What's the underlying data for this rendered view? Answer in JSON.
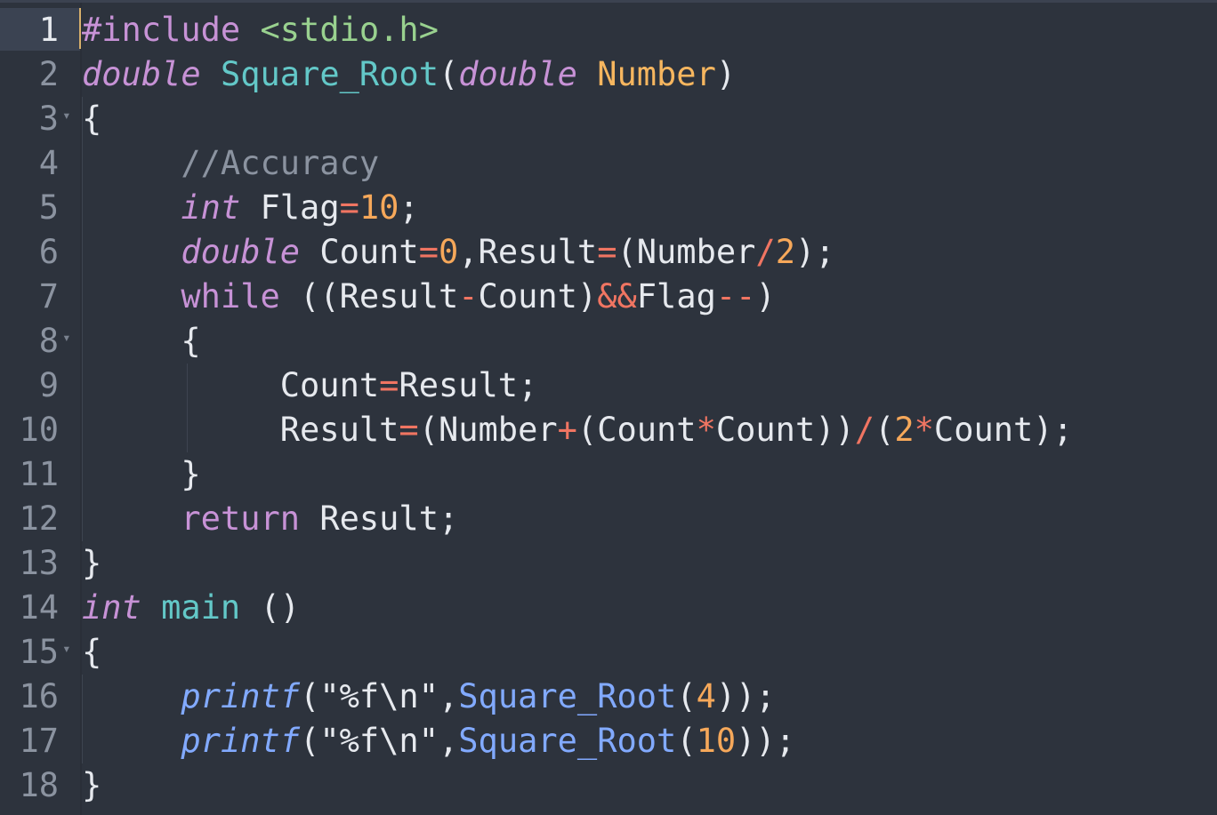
{
  "editor": {
    "language": "c",
    "current_line": 1,
    "theme_colors": {
      "background": "#2d333d",
      "keyword": "#c792d6",
      "function": "#63c8c8",
      "parameter": "#f6b65f",
      "operator": "#f07562",
      "number": "#f6a85a",
      "comment": "#8b93a0",
      "call": "#82aaff",
      "header": "#99d18f",
      "text": "#e6e9ee",
      "cursor": "#d7b06b"
    },
    "lines": [
      {
        "number": "1",
        "foldable": false,
        "tokens": [
          {
            "t": "#include",
            "c": "pp"
          },
          {
            "t": " ",
            "c": "tx"
          },
          {
            "t": "<stdio.h>",
            "c": "hdr"
          }
        ]
      },
      {
        "number": "2",
        "foldable": false,
        "tokens": [
          {
            "t": "double",
            "c": "kw-i"
          },
          {
            "t": " ",
            "c": "tx"
          },
          {
            "t": "Square_Root",
            "c": "fn"
          },
          {
            "t": "(",
            "c": "tx"
          },
          {
            "t": "double",
            "c": "kw-i"
          },
          {
            "t": " ",
            "c": "tx"
          },
          {
            "t": "Number",
            "c": "prm"
          },
          {
            "t": ")",
            "c": "tx"
          }
        ]
      },
      {
        "number": "3",
        "foldable": true,
        "tokens": [
          {
            "t": "{",
            "c": "tx"
          }
        ]
      },
      {
        "number": "4",
        "foldable": false,
        "tokens": [
          {
            "t": "     //Accuracy",
            "c": "cm"
          }
        ]
      },
      {
        "number": "5",
        "foldable": false,
        "tokens": [
          {
            "t": "     ",
            "c": "tx"
          },
          {
            "t": "int",
            "c": "kw-i"
          },
          {
            "t": " Flag",
            "c": "tx"
          },
          {
            "t": "=",
            "c": "op"
          },
          {
            "t": "10",
            "c": "num"
          },
          {
            "t": ";",
            "c": "tx"
          }
        ]
      },
      {
        "number": "6",
        "foldable": false,
        "tokens": [
          {
            "t": "     ",
            "c": "tx"
          },
          {
            "t": "double",
            "c": "kw-i"
          },
          {
            "t": " Count",
            "c": "tx"
          },
          {
            "t": "=",
            "c": "op"
          },
          {
            "t": "0",
            "c": "num"
          },
          {
            "t": ",Result",
            "c": "tx"
          },
          {
            "t": "=",
            "c": "op"
          },
          {
            "t": "(Number",
            "c": "tx"
          },
          {
            "t": "/",
            "c": "op"
          },
          {
            "t": "2",
            "c": "num"
          },
          {
            "t": ");",
            "c": "tx"
          }
        ]
      },
      {
        "number": "7",
        "foldable": false,
        "tokens": [
          {
            "t": "     ",
            "c": "tx"
          },
          {
            "t": "while",
            "c": "kw"
          },
          {
            "t": " ((Result",
            "c": "tx"
          },
          {
            "t": "-",
            "c": "op"
          },
          {
            "t": "Count)",
            "c": "tx"
          },
          {
            "t": "&&",
            "c": "op"
          },
          {
            "t": "Flag",
            "c": "tx"
          },
          {
            "t": "--",
            "c": "op"
          },
          {
            "t": ")",
            "c": "tx"
          }
        ]
      },
      {
        "number": "8",
        "foldable": true,
        "tokens": [
          {
            "t": "     {",
            "c": "tx"
          }
        ]
      },
      {
        "number": "9",
        "foldable": false,
        "tokens": [
          {
            "t": "          Count",
            "c": "tx"
          },
          {
            "t": "=",
            "c": "op"
          },
          {
            "t": "Result;",
            "c": "tx"
          }
        ]
      },
      {
        "number": "10",
        "foldable": false,
        "tokens": [
          {
            "t": "          Result",
            "c": "tx"
          },
          {
            "t": "=",
            "c": "op"
          },
          {
            "t": "(Number",
            "c": "tx"
          },
          {
            "t": "+",
            "c": "op"
          },
          {
            "t": "(Count",
            "c": "tx"
          },
          {
            "t": "*",
            "c": "op"
          },
          {
            "t": "Count))",
            "c": "tx"
          },
          {
            "t": "/",
            "c": "op"
          },
          {
            "t": "(",
            "c": "tx"
          },
          {
            "t": "2",
            "c": "num"
          },
          {
            "t": "*",
            "c": "op"
          },
          {
            "t": "Count);",
            "c": "tx"
          }
        ]
      },
      {
        "number": "11",
        "foldable": false,
        "tokens": [
          {
            "t": "     }",
            "c": "tx"
          }
        ]
      },
      {
        "number": "12",
        "foldable": false,
        "tokens": [
          {
            "t": "     ",
            "c": "tx"
          },
          {
            "t": "return",
            "c": "kw"
          },
          {
            "t": " Result;",
            "c": "tx"
          }
        ]
      },
      {
        "number": "13",
        "foldable": false,
        "tokens": [
          {
            "t": "}",
            "c": "tx"
          }
        ]
      },
      {
        "number": "14",
        "foldable": false,
        "tokens": [
          {
            "t": "int",
            "c": "kw-i"
          },
          {
            "t": " ",
            "c": "tx"
          },
          {
            "t": "main",
            "c": "fn"
          },
          {
            "t": " ()",
            "c": "tx"
          }
        ]
      },
      {
        "number": "15",
        "foldable": true,
        "tokens": [
          {
            "t": "{",
            "c": "tx"
          }
        ]
      },
      {
        "number": "16",
        "foldable": false,
        "tokens": [
          {
            "t": "     ",
            "c": "tx"
          },
          {
            "t": "printf",
            "c": "call-i"
          },
          {
            "t": "(\"%f\\n\",",
            "c": "str"
          },
          {
            "t": "Square_Root",
            "c": "call"
          },
          {
            "t": "(",
            "c": "tx"
          },
          {
            "t": "4",
            "c": "num"
          },
          {
            "t": "));",
            "c": "tx"
          }
        ]
      },
      {
        "number": "17",
        "foldable": false,
        "tokens": [
          {
            "t": "     ",
            "c": "tx"
          },
          {
            "t": "printf",
            "c": "call-i"
          },
          {
            "t": "(\"%f\\n\",",
            "c": "str"
          },
          {
            "t": "Square_Root",
            "c": "call"
          },
          {
            "t": "(",
            "c": "tx"
          },
          {
            "t": "10",
            "c": "num"
          },
          {
            "t": "));",
            "c": "tx"
          }
        ]
      },
      {
        "number": "18",
        "foldable": false,
        "tokens": [
          {
            "t": "}",
            "c": "tx"
          }
        ]
      }
    ]
  }
}
